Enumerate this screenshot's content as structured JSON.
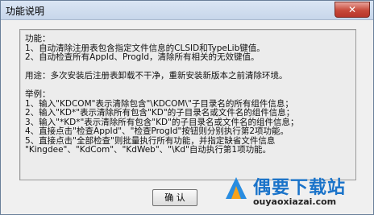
{
  "window": {
    "title": "功能说明",
    "close_glyph": "✕"
  },
  "content": {
    "lines": [
      "功能：",
      "1、自动清除注册表包含指定文件信息的CLSID和TypeLib键值。",
      "2、自动检查所有AppId、ProgId，清除所有相关的无效键值。",
      "",
      "用途：多次安装后注册表卸载不干净，重新安装新版本之前清除环境。",
      "",
      "举例：",
      "1、输入\"KDCOM\"表示清除包含\"\\KDCOM\\\"子目录名的所有组件信息；",
      "2、输入\"KD*\"表示清除所有包含\"KD\"的子目录名或文件名的组件信息；",
      "3、输入\"*KD*\"表示清除所有包含\"KD\"的子目录名或文件名的组件信息；",
      "4、直接点击\"检查AppId\"、\"检查ProgId\"按钮则分别执行第2项功能。",
      "5、直接点击\"全部检查\"则批量执行所有功能，并指定缺省文件信息",
      "\"Kingdee\"、\"KdCom\"、\"KdWeb\"、\"\\Kd\"自动执行第1项功能。"
    ]
  },
  "buttons": {
    "ok_label": "确 认"
  },
  "watermark": {
    "title": "偶要下载站",
    "url": "ouyaoxiazai.com"
  }
}
